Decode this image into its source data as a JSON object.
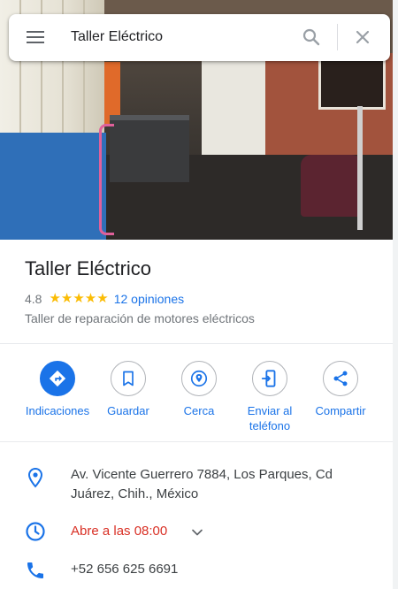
{
  "search": {
    "query": "Taller Eléctrico"
  },
  "place": {
    "title": "Taller Eléctrico",
    "rating": "4.8",
    "stars": "★★★★★",
    "reviews": "12 opiniones",
    "category": "Taller de reparación de motores eléctricos"
  },
  "actions": [
    {
      "label": "Indicaciones",
      "icon": "directions-icon"
    },
    {
      "label": "Guardar",
      "icon": "bookmark-icon"
    },
    {
      "label": "Cerca",
      "icon": "nearby-icon"
    },
    {
      "label": "Enviar al teléfono",
      "icon": "send-to-phone-icon"
    },
    {
      "label": "Compartir",
      "icon": "share-icon"
    }
  ],
  "info": {
    "address": "Av. Vicente Guerrero 7884, Los Parques, Cd Juárez, Chih., México",
    "hours": "Abre a las 08:00",
    "phone": "+52 656 625 6691"
  },
  "colors": {
    "accent": "#1a73e8",
    "star": "#fbbc04",
    "closed": "#d93025"
  }
}
